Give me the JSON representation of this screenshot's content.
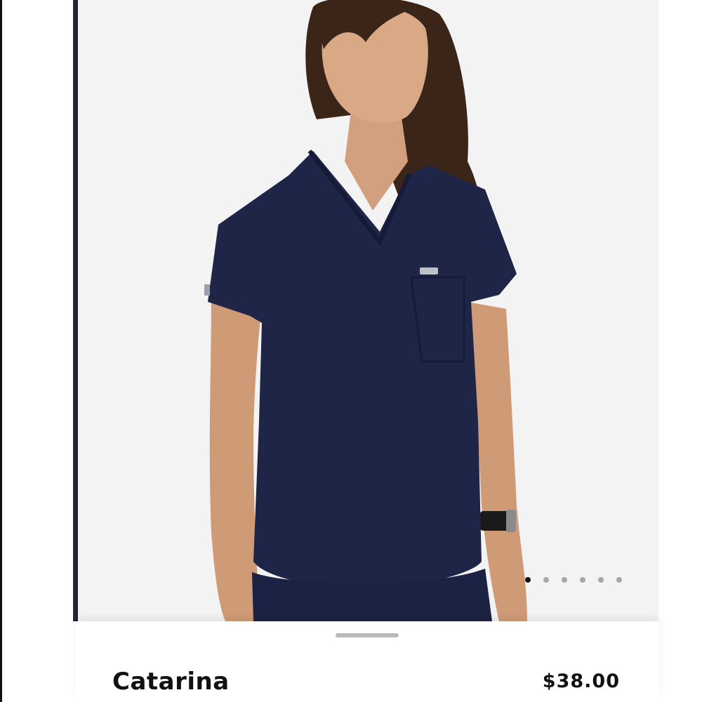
{
  "product": {
    "name": "Catarina",
    "price": "$38.00",
    "image_subject": "woman-wearing-navy-v-neck-scrub-top",
    "garment_color": "#1f2547"
  },
  "carousel": {
    "total_slides": 6,
    "active_index": 0
  },
  "colors": {
    "photo_background": "#f3f3f4",
    "text": "#111111",
    "dot_inactive": "#a7a7a7",
    "dot_active": "#111111",
    "handle": "#b9b9b9"
  }
}
